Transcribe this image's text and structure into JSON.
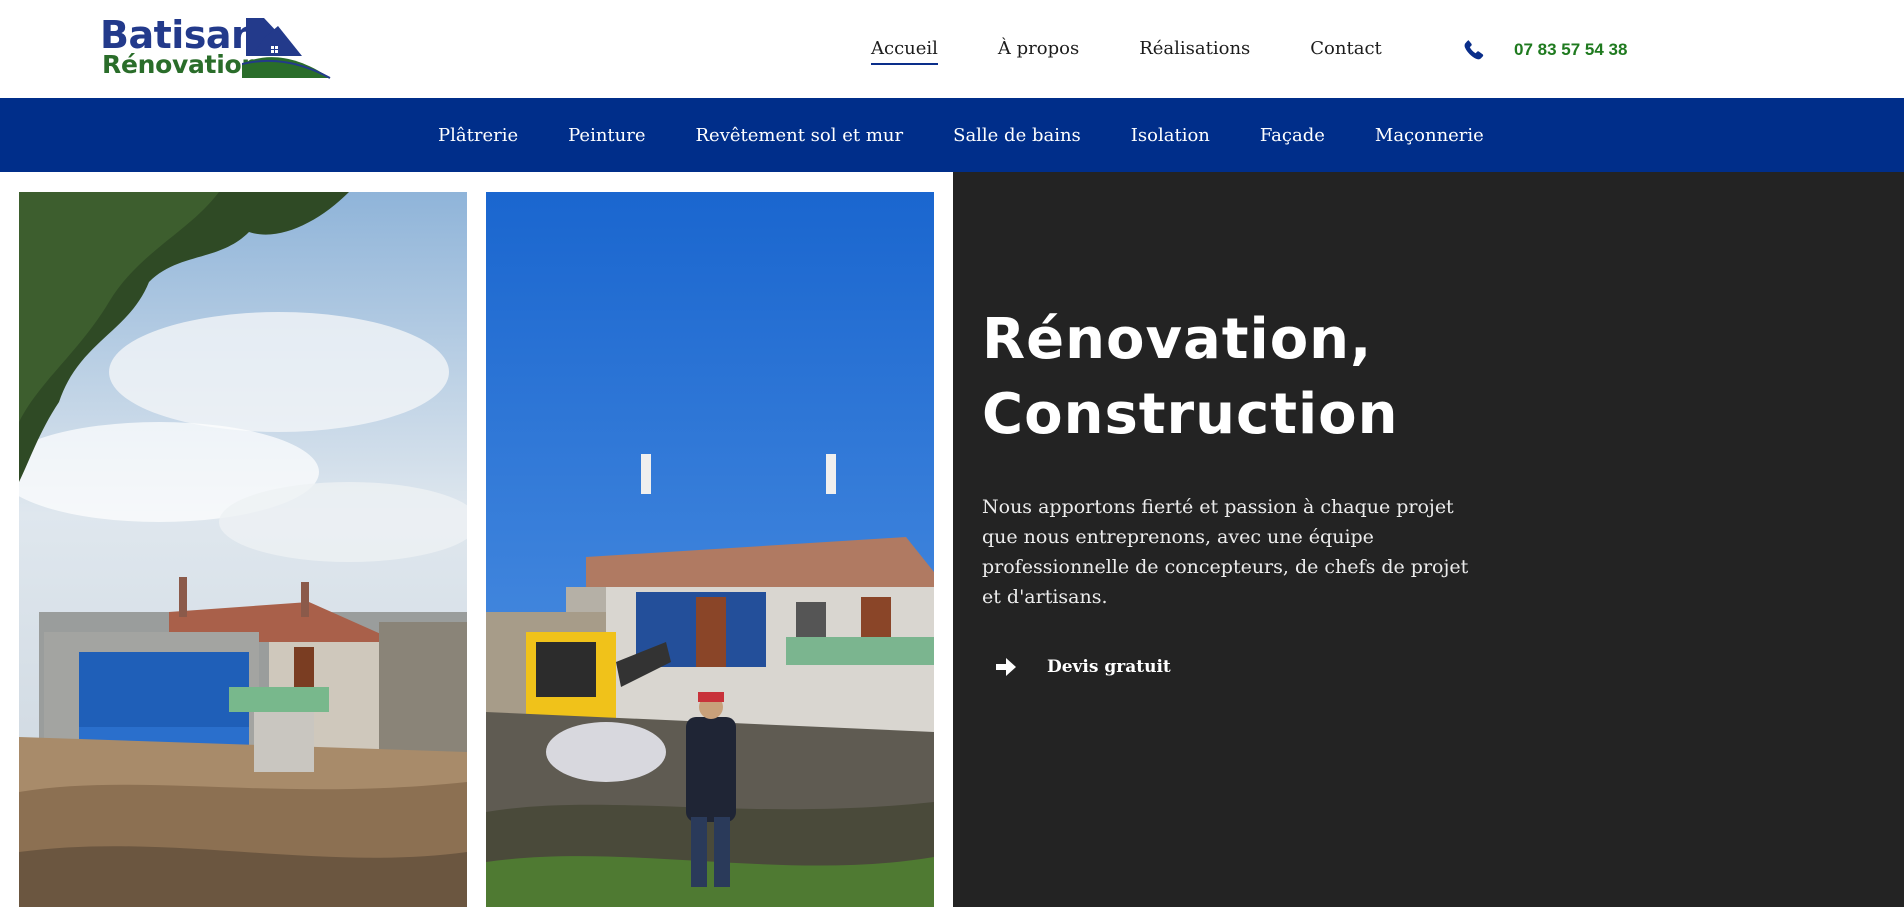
{
  "brand": {
    "name_line1": "Batisan",
    "name_line2": "Rénovation",
    "colors": {
      "primary": "#233a8b",
      "secondary": "#2a6d2a"
    }
  },
  "nav": {
    "items": [
      {
        "label": "Accueil",
        "active": true
      },
      {
        "label": "À propos",
        "active": false
      },
      {
        "label": "Réalisations",
        "active": false
      },
      {
        "label": "Contact",
        "active": false
      }
    ],
    "phone": {
      "icon": "phone-icon",
      "number": "07 83 57 54 38",
      "color": "#1f7a1f"
    }
  },
  "services": {
    "background": "#002e8a",
    "items": [
      "Plâtrerie",
      "Peinture",
      "Revêtement sol et mur",
      "Salle de bains",
      "Isolation",
      "Façade",
      "Maçonnerie"
    ]
  },
  "hero": {
    "title_line1": "Rénovation,",
    "title_line2": "Construction",
    "text": "Nous apportons fierté et passion à chaque projet que nous entreprenons, avec une équipe professionnelle de concepteurs, de chefs de projet et d'artisans.",
    "cta": {
      "icon": "arrow-right-icon",
      "label": "Devis gratuit"
    }
  }
}
